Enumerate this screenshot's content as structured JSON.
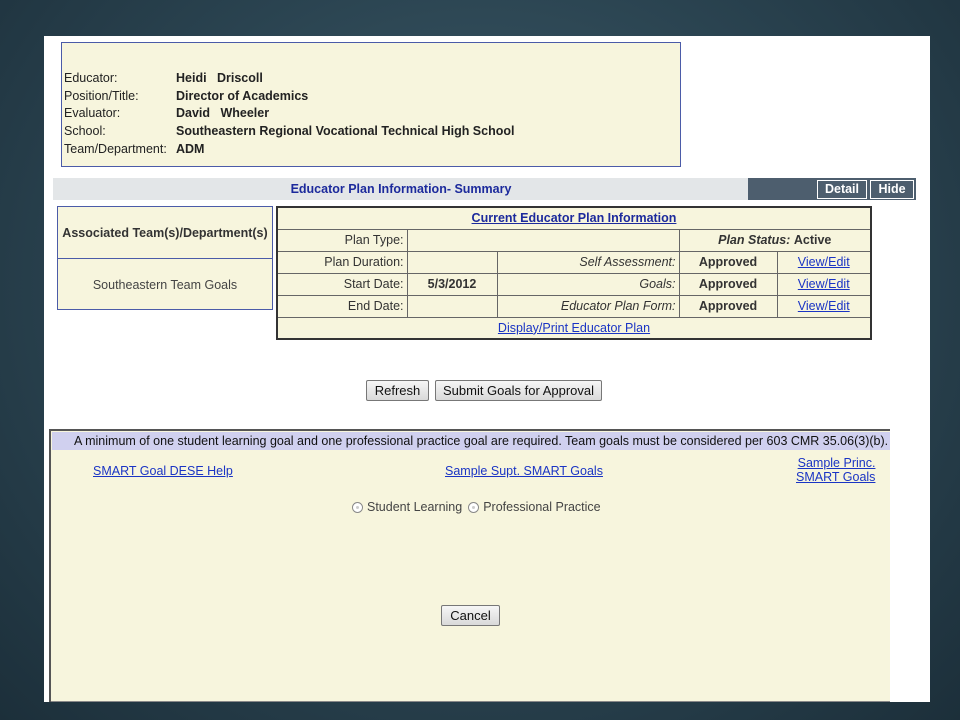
{
  "educator": {
    "rows": [
      {
        "label": "Educator:",
        "value": "Heidi   Driscoll"
      },
      {
        "label": "Position/Title:",
        "value": "Director of Academics"
      },
      {
        "label": "Evaluator:",
        "value": "David   Wheeler"
      },
      {
        "label": "School:",
        "value": "Southeastern Regional Vocational Technical High School"
      },
      {
        "label": "Team/Department:",
        "value": "ADM"
      }
    ]
  },
  "summary": {
    "title": "Educator Plan Information- Summary",
    "detail_label": "Detail",
    "hide_label": "Hide"
  },
  "assoc": {
    "header": "Associated Team(s)/Department(s)",
    "item": "Southeastern Team Goals"
  },
  "plan": {
    "title": "Current Educator Plan Information",
    "plan_type_label": "Plan Type:",
    "plan_status_label": "Plan Status:",
    "plan_status_value": "Active",
    "duration_label": "Plan Duration:",
    "start_label": "Start Date:",
    "start_value": "5/3/2012",
    "end_label": "End Date:",
    "self_assessment_label": "Self Assessment:",
    "goals_label": "Goals:",
    "form_label": "Educator Plan Form:",
    "approved": "Approved",
    "view_edit": "View/Edit",
    "print_link": "Display/Print Educator Plan"
  },
  "actions": {
    "refresh": "Refresh",
    "submit": "Submit Goals for Approval"
  },
  "goals": {
    "notice": "A minimum of one student learning goal and one professional practice goal are required. Team goals must be considered per 603 CMR 35.06(3)(b).",
    "link_dese": "SMART Goal DESE Help",
    "link_supt": "Sample Supt. SMART Goals",
    "link_princ_1": "Sample Princ.",
    "link_princ_2": "SMART Goals",
    "radio_student": "Student Learning",
    "radio_professional": "Professional Practice",
    "cancel": "Cancel"
  }
}
